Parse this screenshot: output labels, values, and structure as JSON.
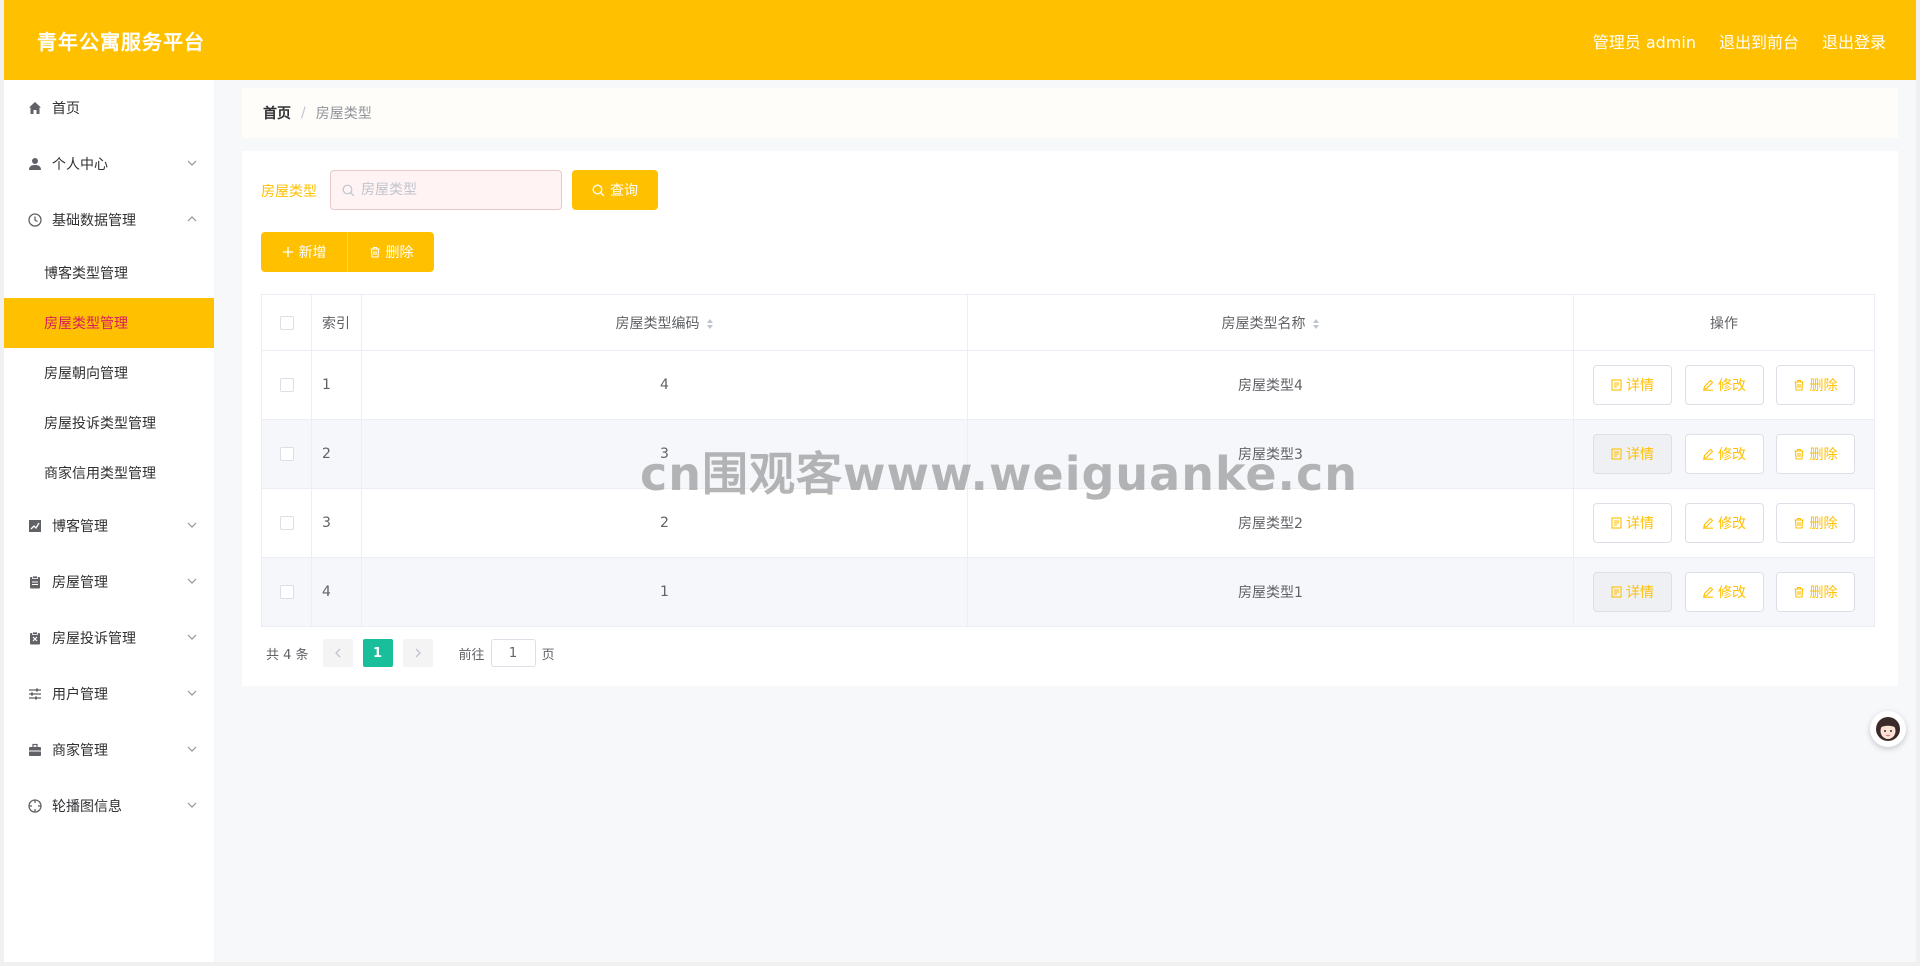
{
  "header": {
    "title": "青年公寓服务平台",
    "admin_label": "管理员 admin",
    "to_front": "退出到前台",
    "logout": "退出登录"
  },
  "sidebar": {
    "items": [
      {
        "label": "首页",
        "icon": "home-icon"
      },
      {
        "label": "个人中心",
        "icon": "user-icon"
      },
      {
        "label": "基础数据管理",
        "icon": "clock-icon"
      },
      {
        "label": "博客管理",
        "icon": "chart-icon"
      },
      {
        "label": "房屋管理",
        "icon": "clipboard-icon"
      },
      {
        "label": "房屋投诉管理",
        "icon": "report-icon"
      },
      {
        "label": "用户管理",
        "icon": "sliders-icon"
      },
      {
        "label": "商家管理",
        "icon": "briefcase-icon"
      },
      {
        "label": "轮播图信息",
        "icon": "compass-icon"
      }
    ],
    "sub_items": [
      {
        "label": "博客类型管理"
      },
      {
        "label": "房屋类型管理",
        "active": true
      },
      {
        "label": "房屋朝向管理"
      },
      {
        "label": "房屋投诉类型管理"
      },
      {
        "label": "商家信用类型管理"
      }
    ]
  },
  "breadcrumb": {
    "home": "首页",
    "separator": "/",
    "current": "房屋类型"
  },
  "search": {
    "label": "房屋类型",
    "placeholder": "房屋类型",
    "button": "查询"
  },
  "toolbar": {
    "add": "新增",
    "delete": "删除"
  },
  "table": {
    "headers": {
      "index": "索引",
      "code": "房屋类型编码",
      "name": "房屋类型名称",
      "ops": "操作"
    },
    "rows": [
      {
        "index": "1",
        "code": "4",
        "name": "房屋类型4"
      },
      {
        "index": "2",
        "code": "3",
        "name": "房屋类型3"
      },
      {
        "index": "3",
        "code": "2",
        "name": "房屋类型2"
      },
      {
        "index": "4",
        "code": "1",
        "name": "房屋类型1"
      }
    ],
    "op_labels": {
      "detail": "详情",
      "edit": "修改",
      "delete": "删除"
    }
  },
  "pagination": {
    "total": "共 4 条",
    "current": "1",
    "goto_label": "前往",
    "goto_value": "1",
    "page_unit": "页"
  },
  "watermark": "cn围观客www.weiguanke.cn",
  "colors": {
    "accent": "#ffc000",
    "active_text": "#d81b60",
    "page_active": "#19be9b"
  }
}
